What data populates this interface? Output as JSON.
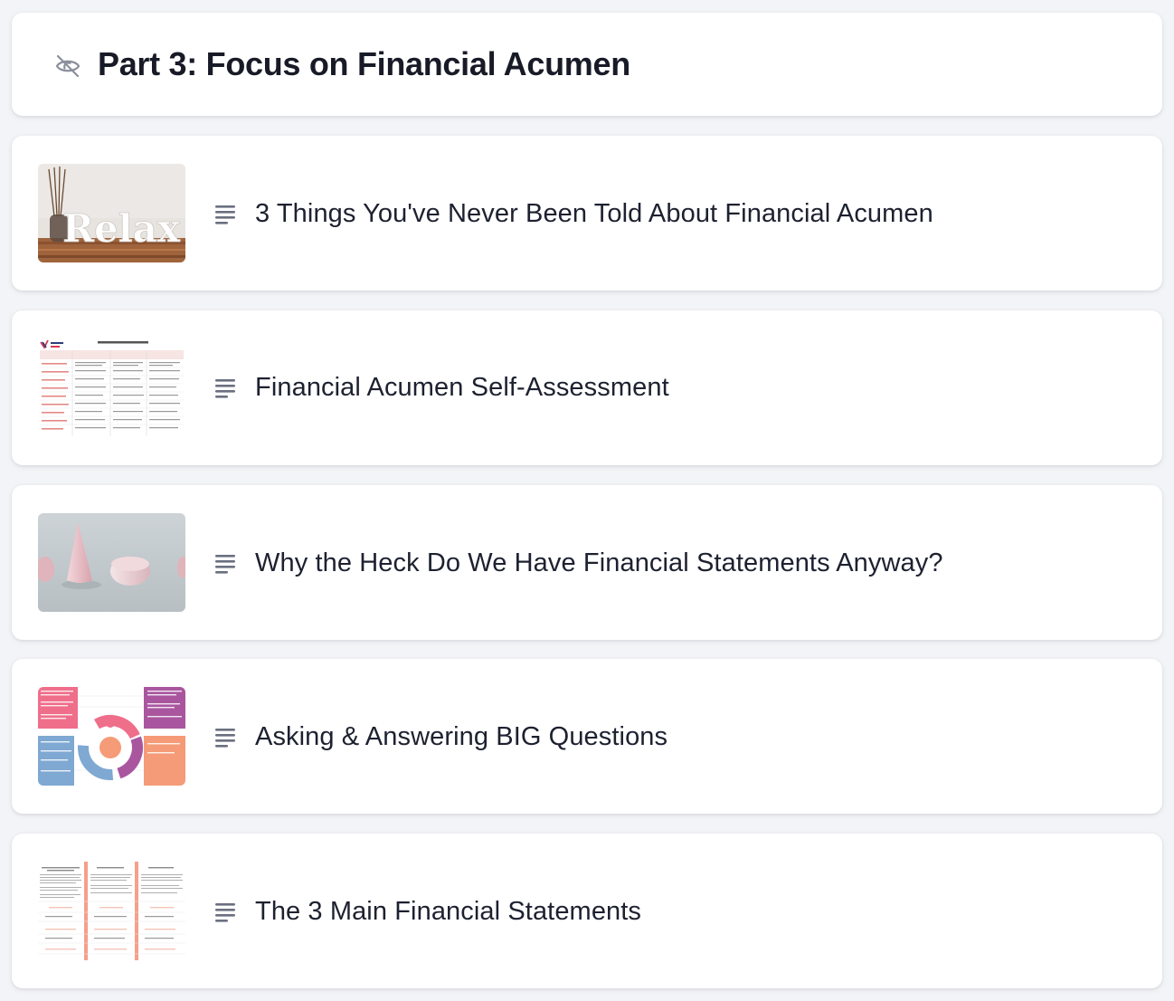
{
  "section": {
    "title": "Part 3: Focus on Financial Acumen",
    "visibility_icon": "eye-off-icon"
  },
  "lessons": [
    {
      "title": "3 Things You've Never Been Told About Financial Acumen",
      "type_icon": "text-lines-icon",
      "thumbnail": "relax-photo-thumbnail",
      "thumbnail_text": "Relax"
    },
    {
      "title": "Financial Acumen Self-Assessment",
      "type_icon": "text-lines-icon",
      "thumbnail": "self-assessment-table-thumbnail"
    },
    {
      "title": "Why the Heck Do We Have Financial Statements Anyway?",
      "type_icon": "text-lines-icon",
      "thumbnail": "pink-shapes-photo-thumbnail"
    },
    {
      "title": "Asking & Answering BIG Questions",
      "type_icon": "text-lines-icon",
      "thumbnail": "big-questions-diagram-thumbnail"
    },
    {
      "title": "The 3 Main Financial Statements",
      "type_icon": "text-lines-icon",
      "thumbnail": "financial-statements-table-thumbnail"
    }
  ],
  "colors": {
    "background": "#f3f4f7",
    "card": "#ffffff",
    "title_text": "#181b27",
    "icon_gray": "#6b7080"
  }
}
